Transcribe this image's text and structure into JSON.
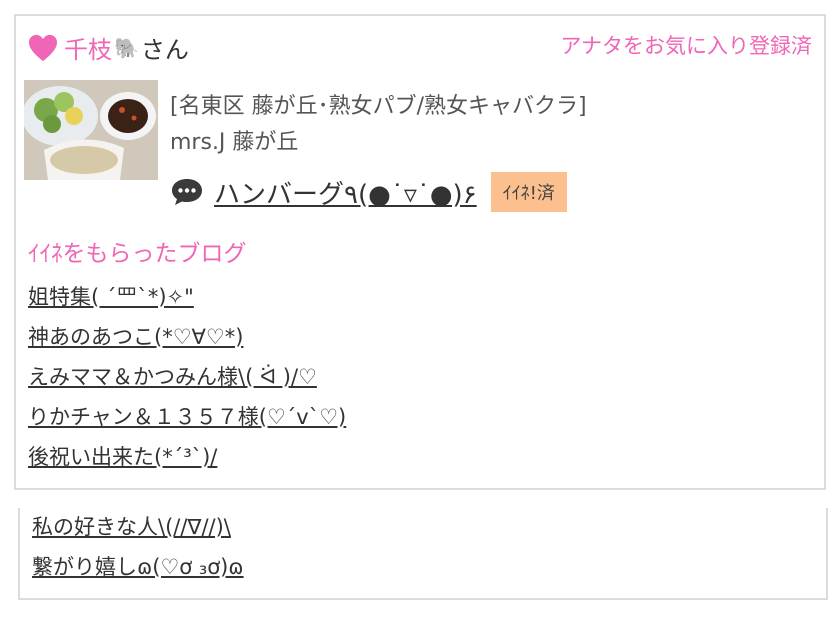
{
  "header": {
    "username": "千枝",
    "emoji": "🐘",
    "honorific": "さん",
    "favorite_status": "アナタをお気に入り登録済"
  },
  "shop": {
    "area_category": "[名東区 藤が丘･熟女パブ/熟女キャバクラ]",
    "name": "mrs.J 藤が丘"
  },
  "post": {
    "title": "ハンバーグ٩(●˙▿˙●)۶",
    "like_status": "ｲｲﾈ!済"
  },
  "liked_blogs": {
    "heading": "ｲｲﾈをもらったブログ",
    "items": [
      {
        "label": "姐特集( ´罒`*)✧\""
      },
      {
        "label": "神あのあつこ(*♡∀♡*)"
      },
      {
        "label": "えみママ＆かつみん様\\( ᐛ )/♡"
      },
      {
        "label": "りかチャン＆１３５７様(♡´ᴠ`♡)"
      },
      {
        "label": "後祝い出来た(*´³`)/"
      },
      {
        "label": "私の好きな人\\(//∇//)\\"
      },
      {
        "label": "繋がり嬉しɷ(♡ơ ₃ơ)ɷ"
      }
    ]
  },
  "colors": {
    "accent_pink": "#ef66b6",
    "badge_orange": "#fbc08e",
    "border_gray": "#dcdcdc"
  },
  "icons": {
    "heart": "heart-icon",
    "comment": "speech-bubble-icon"
  }
}
